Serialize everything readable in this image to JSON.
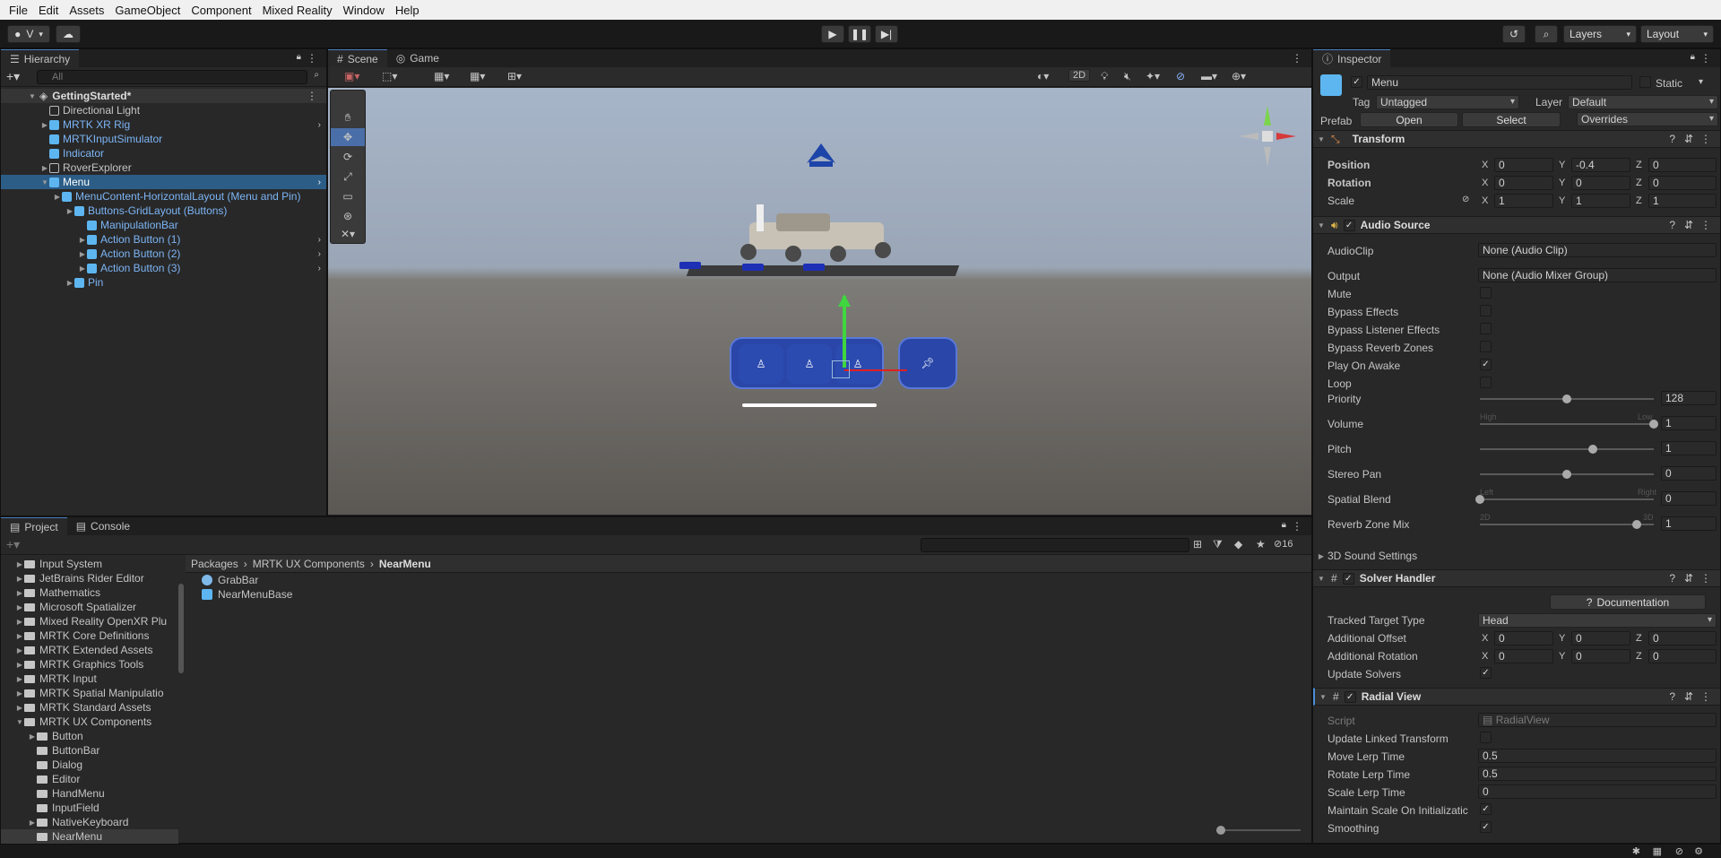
{
  "menubar": [
    "File",
    "Edit",
    "Assets",
    "GameObject",
    "Component",
    "Mixed Reality",
    "Window",
    "Help"
  ],
  "toolbar": {
    "account_label": "V",
    "layers_label": "Layers",
    "layout_label": "Layout"
  },
  "hierarchy": {
    "tab": "Hierarchy",
    "search_placeholder": "All",
    "scene": "GettingStarted*",
    "items": [
      {
        "label": "Directional Light",
        "indent": 1,
        "blue": false,
        "arrow": false,
        "sel": false
      },
      {
        "label": "MRTK XR Rig",
        "indent": 1,
        "blue": true,
        "arrow": true,
        "sel": false
      },
      {
        "label": "MRTKInputSimulator",
        "indent": 1,
        "blue": true,
        "arrow": false,
        "sel": false
      },
      {
        "label": "Indicator",
        "indent": 1,
        "blue": true,
        "arrow": false,
        "sel": false
      },
      {
        "label": "RoverExplorer",
        "indent": 1,
        "blue": false,
        "arrow": true,
        "sel": false
      },
      {
        "label": "Menu",
        "indent": 1,
        "blue": true,
        "arrow": true,
        "sel": true
      },
      {
        "label": "MenuContent-HorizontalLayout (Menu and Pin)",
        "indent": 2,
        "blue": true,
        "arrow": true,
        "sel": false
      },
      {
        "label": "Buttons-GridLayout (Buttons)",
        "indent": 3,
        "blue": true,
        "arrow": true,
        "sel": false
      },
      {
        "label": "ManipulationBar",
        "indent": 4,
        "blue": true,
        "arrow": false,
        "sel": false
      },
      {
        "label": "Action Button (1)",
        "indent": 4,
        "blue": true,
        "arrow": true,
        "sel": false
      },
      {
        "label": "Action Button (2)",
        "indent": 4,
        "blue": true,
        "arrow": true,
        "sel": false
      },
      {
        "label": "Action Button (3)",
        "indent": 4,
        "blue": true,
        "arrow": true,
        "sel": false
      },
      {
        "label": "Pin",
        "indent": 3,
        "blue": true,
        "arrow": true,
        "sel": false
      }
    ]
  },
  "scene": {
    "tabs": [
      "Scene",
      "Game"
    ],
    "mode_2d": "2D"
  },
  "project": {
    "tabs": [
      "Project",
      "Console"
    ],
    "count": "16",
    "breadcrumb": [
      "Packages",
      "MRTK UX Components",
      "NearMenu"
    ],
    "tree": [
      {
        "label": "Input System",
        "indent": 0,
        "arrow": true
      },
      {
        "label": "JetBrains Rider Editor",
        "indent": 0,
        "arrow": true
      },
      {
        "label": "Mathematics",
        "indent": 0,
        "arrow": true
      },
      {
        "label": "Microsoft Spatializer",
        "indent": 0,
        "arrow": true
      },
      {
        "label": "Mixed Reality OpenXR Plu",
        "indent": 0,
        "arrow": true
      },
      {
        "label": "MRTK Core Definitions",
        "indent": 0,
        "arrow": true
      },
      {
        "label": "MRTK Extended Assets",
        "indent": 0,
        "arrow": true
      },
      {
        "label": "MRTK Graphics Tools",
        "indent": 0,
        "arrow": true
      },
      {
        "label": "MRTK Input",
        "indent": 0,
        "arrow": true
      },
      {
        "label": "MRTK Spatial Manipulatio",
        "indent": 0,
        "arrow": true
      },
      {
        "label": "MRTK Standard Assets",
        "indent": 0,
        "arrow": true
      },
      {
        "label": "MRTK UX Components",
        "indent": 0,
        "arrow": true
      },
      {
        "label": "Button",
        "indent": 1,
        "arrow": true
      },
      {
        "label": "ButtonBar",
        "indent": 1,
        "arrow": false
      },
      {
        "label": "Dialog",
        "indent": 1,
        "arrow": false
      },
      {
        "label": "Editor",
        "indent": 1,
        "arrow": false
      },
      {
        "label": "HandMenu",
        "indent": 1,
        "arrow": false
      },
      {
        "label": "InputField",
        "indent": 1,
        "arrow": false
      },
      {
        "label": "NativeKeyboard",
        "indent": 1,
        "arrow": true
      },
      {
        "label": "NearMenu",
        "indent": 1,
        "arrow": false
      }
    ],
    "assets": [
      "GrabBar",
      "NearMenuBase"
    ]
  },
  "inspector": {
    "tab": "Inspector",
    "object_name": "Menu",
    "static_label": "Static",
    "tag_label": "Tag",
    "tag_value": "Untagged",
    "layer_label": "Layer",
    "layer_value": "Default",
    "prefab_label": "Prefab",
    "open_label": "Open",
    "select_label": "Select",
    "overrides_label": "Overrides",
    "transform": {
      "title": "Transform",
      "position": {
        "label": "Position",
        "x": "0",
        "y": "-0.4",
        "z": "0"
      },
      "rotation": {
        "label": "Rotation",
        "x": "0",
        "y": "0",
        "z": "0"
      },
      "scale": {
        "label": "Scale",
        "x": "1",
        "y": "1",
        "z": "1"
      }
    },
    "audio": {
      "title": "Audio Source",
      "audioclip_label": "AudioClip",
      "audioclip_value": "None (Audio Clip)",
      "output_label": "Output",
      "output_value": "None (Audio Mixer Group)",
      "mute": "Mute",
      "bypass_effects": "Bypass Effects",
      "bypass_listener": "Bypass Listener Effects",
      "bypass_reverb": "Bypass Reverb Zones",
      "play_on_awake": "Play On Awake",
      "loop": "Loop",
      "priority": {
        "label": "Priority",
        "value": "128",
        "high": "High",
        "low": "Low",
        "level": 0.5
      },
      "volume": {
        "label": "Volume",
        "value": "1",
        "level": 1.0
      },
      "pitch": {
        "label": "Pitch",
        "value": "1",
        "level": 0.65
      },
      "stereo_pan": {
        "label": "Stereo Pan",
        "value": "0",
        "left": "Left",
        "right": "Right",
        "level": 0.5
      },
      "spatial_blend": {
        "label": "Spatial Blend",
        "value": "0",
        "d2": "2D",
        "d3": "3D",
        "level": 0.0
      },
      "reverb_mix": {
        "label": "Reverb Zone Mix",
        "value": "1",
        "level": 0.9
      },
      "sound_settings": "3D Sound Settings"
    },
    "solver": {
      "title": "Solver Handler",
      "documentation": "Documentation",
      "tracked_label": "Tracked Target Type",
      "tracked_value": "Head",
      "offset_label": "Additional Offset",
      "offset": {
        "x": "0",
        "y": "0",
        "z": "0"
      },
      "rotation_label": "Additional Rotation",
      "rotation": {
        "x": "0",
        "y": "0",
        "z": "0"
      },
      "update_solvers": "Update Solvers"
    },
    "radial": {
      "title": "Radial View",
      "script_label": "Script",
      "script_value": "RadialView",
      "update_linked": "Update Linked Transform",
      "move_label": "Move Lerp Time",
      "move_value": "0.5",
      "rotate_label": "Rotate Lerp Time",
      "rotate_value": "0.5",
      "scale_label": "Scale Lerp Time",
      "scale_value": "0",
      "maintain_label": "Maintain Scale On Initializatic",
      "smoothing_label": "Smoothing"
    }
  }
}
